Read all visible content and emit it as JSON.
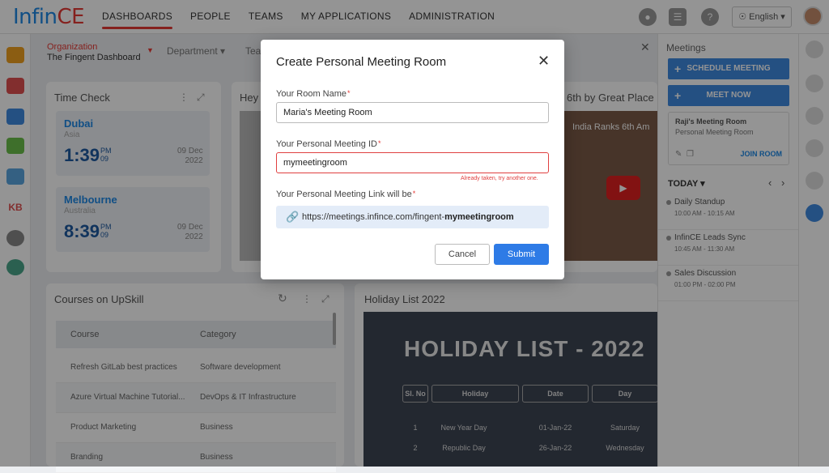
{
  "app": {
    "logo_part1": "Infin",
    "logo_part2": "CE"
  },
  "nav": [
    "DASHBOARDS",
    "PEOPLE",
    "TEAMS",
    "MY APPLICATIONS",
    "ADMINISTRATION"
  ],
  "topbar": {
    "language": "English"
  },
  "subnav": {
    "org_label": "Organization",
    "org_value": "The Fingent Dashboard",
    "department": "Department",
    "team": "Tea"
  },
  "time_check": {
    "title": "Time Check",
    "cities": [
      {
        "name": "Dubai",
        "country": "Asia",
        "time": "1:39",
        "ampm": "PM",
        "sec": "09",
        "date1": "09 Dec",
        "date2": "2022"
      },
      {
        "name": "Melbourne",
        "country": "Australia",
        "time": "8:39",
        "ampm": "PM",
        "sec": "09",
        "date1": "09 Dec",
        "date2": "2022"
      }
    ]
  },
  "hey_card": {
    "title": "Hey"
  },
  "great_place": {
    "title": "6th by Great Place",
    "video_caption": "India Ranks 6th Am"
  },
  "courses": {
    "title": "Courses on UpSkill",
    "headers": [
      "Course",
      "Category"
    ],
    "rows": [
      [
        "Refresh GitLab best practices",
        "Software development"
      ],
      [
        "Azure Virtual Machine Tutorial...",
        "DevOps & IT Infrastructure"
      ],
      [
        "Product Marketing",
        "Business"
      ],
      [
        "Branding",
        "Business"
      ]
    ]
  },
  "holiday": {
    "title": "Holiday List 2022",
    "banner": "HOLIDAY LIST - 2022",
    "headers": [
      "Sl. No",
      "Holiday",
      "Date",
      "Day"
    ],
    "rows": [
      [
        "1",
        "New Year Day",
        "01-Jan-22",
        "Saturday"
      ],
      [
        "2",
        "Republic Day",
        "26-Jan-22",
        "Wednesday"
      ]
    ]
  },
  "meetings": {
    "title": "Meetings",
    "schedule": "SCHEDULE MEETING",
    "meet_now": "MEET NOW",
    "room_title": "Raji's Meeting Room",
    "room_sub": "Personal Meeting Room",
    "join": "JOIN ROOM",
    "today": "TODAY",
    "events": [
      {
        "name": "Daily Standup",
        "time": "10:00 AM - 10:15 AM"
      },
      {
        "name": "InfinCE Leads Sync",
        "time": "10:45 AM - 11:30 AM"
      },
      {
        "name": "Sales Discussion",
        "time": "01:00 PM - 02:00 PM"
      }
    ]
  },
  "modal": {
    "title": "Create Personal Meeting Room",
    "room_name_label": "Your Room Name",
    "room_name_value": "Maria's Meeting Room",
    "meeting_id_label": "Your Personal Meeting ID",
    "meeting_id_value": "mymeetingroom",
    "error": "Already taken, try another one.",
    "link_label": "Your Personal Meeting Link will be",
    "link_prefix": "https://meetings.infince.com/fingent-",
    "link_suffix": "mymeetingroom",
    "cancel": "Cancel",
    "submit": "Submit"
  },
  "colors": {
    "accent": "#2e7be6",
    "error": "#e04040",
    "brand_red": "#e53935"
  }
}
